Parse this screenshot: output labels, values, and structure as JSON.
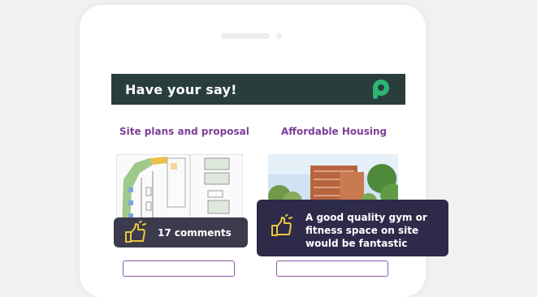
{
  "header": {
    "title": "Have your say!",
    "logo_icon": "p-logo-icon"
  },
  "cards": [
    {
      "title": "Site plans and proposal"
    },
    {
      "title": "Affordable Housing"
    }
  ],
  "comment_badge": {
    "text": "17 comments",
    "icon": "thumbs-up-icon"
  },
  "quote_badge": {
    "text": "A good quality gym or fitness space on site would be fantastic",
    "icon": "thumbs-up-icon"
  },
  "colors": {
    "header_bg": "#2a3d3d",
    "accent_green": "#2bb673",
    "title_purple": "#7d3f98",
    "badge_bg": "#3c3b4d",
    "quote_bg": "#2d2a4a",
    "icon_yellow": "#e9c63a"
  }
}
